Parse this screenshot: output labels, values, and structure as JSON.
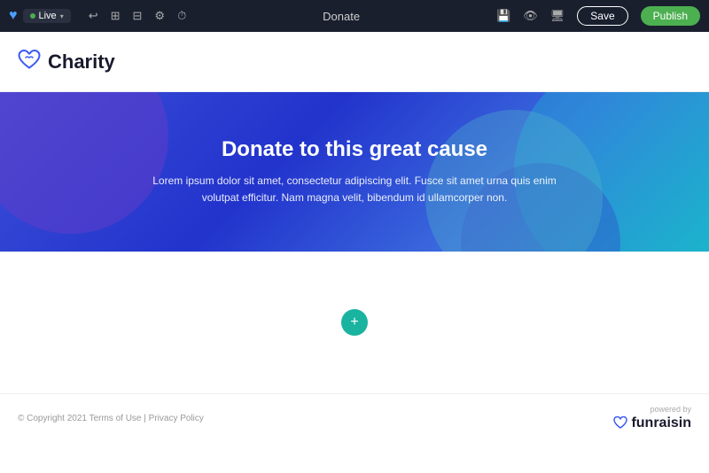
{
  "topbar": {
    "live_label": "Live",
    "icons": [
      "history",
      "image",
      "layout",
      "settings",
      "clock"
    ],
    "center_link": "Donate",
    "save_label": "Save",
    "publish_label": "Publish"
  },
  "header": {
    "logo_text": "Charity"
  },
  "hero": {
    "title": "Donate to this great cause",
    "subtitle": "Lorem ipsum dolor sit amet, consectetur adipiscing elit. Fusce sit amet urna quis enim volutpat efficitur. Nam magna velit, bibendum id ullamcorper non."
  },
  "footer": {
    "copyright": "© Copyright 2021",
    "terms_label": "Terms of Use",
    "privacy_label": "Privacy Policy",
    "powered_label": "powered by",
    "brand_label": "funraisin"
  }
}
